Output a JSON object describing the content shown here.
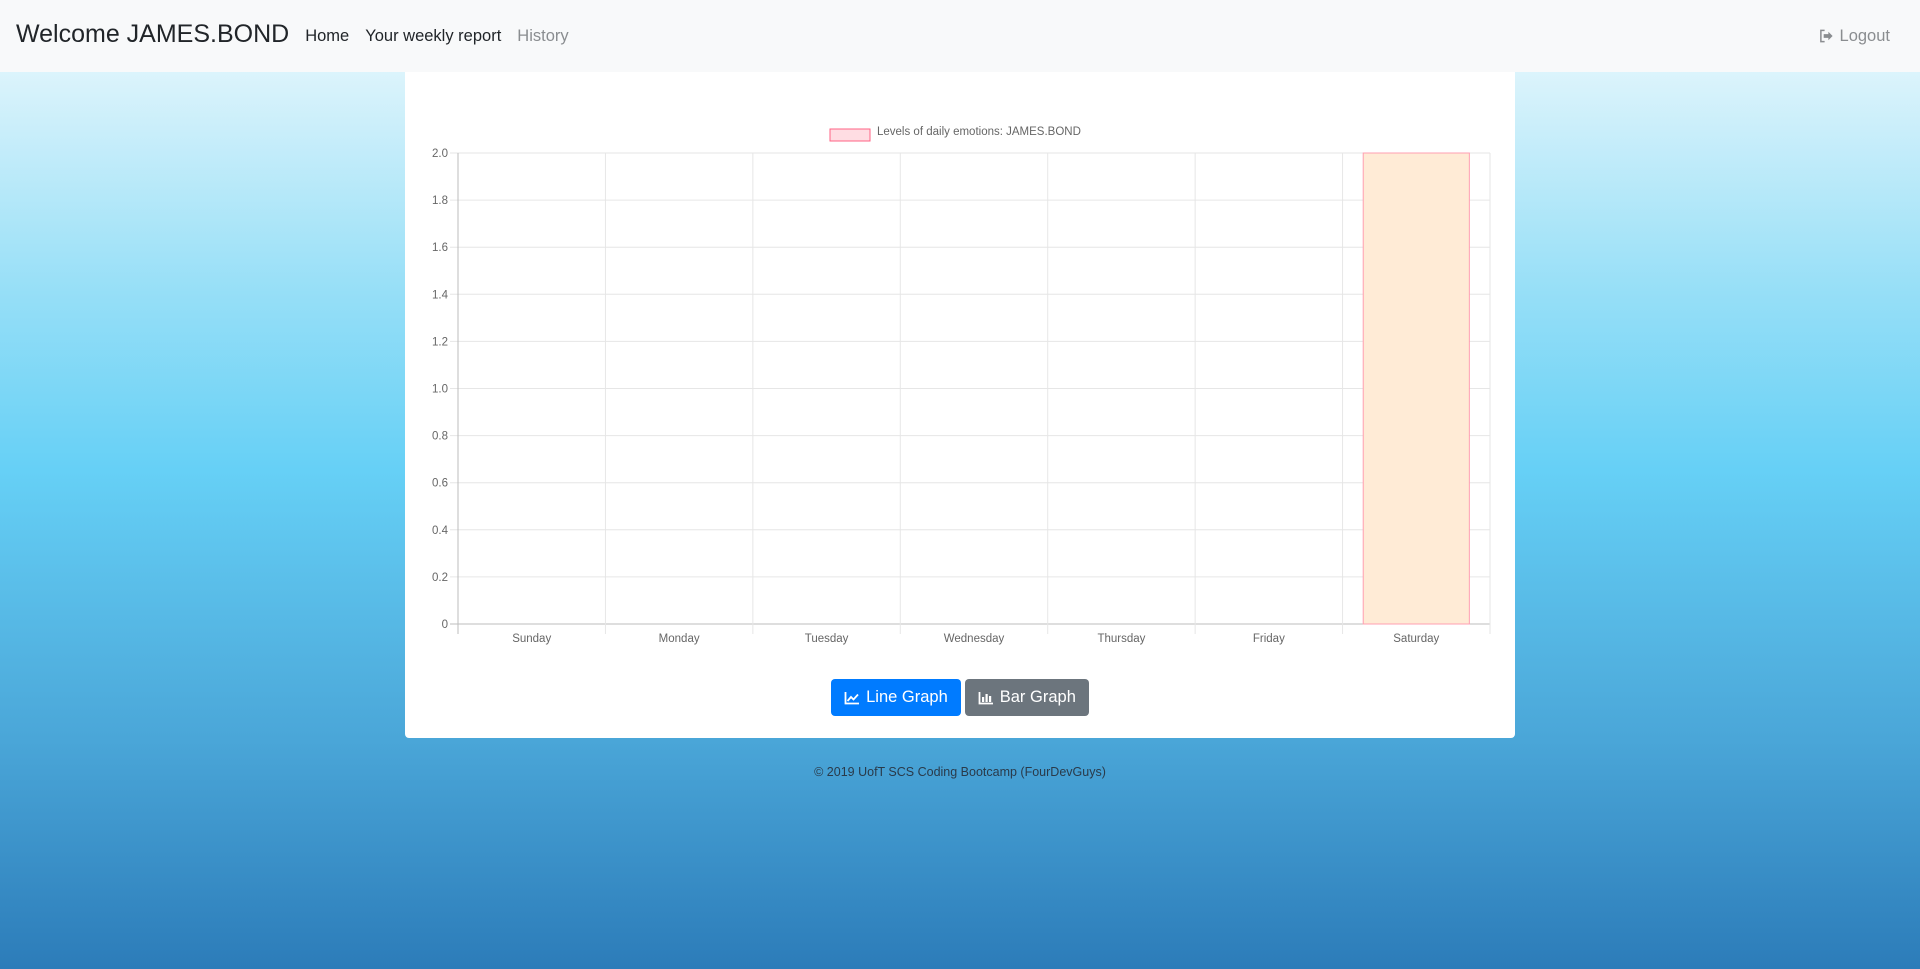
{
  "navbar": {
    "brand": "Welcome JAMES.BOND",
    "links": [
      {
        "label": "Home"
      },
      {
        "label": "Your weekly report"
      },
      {
        "label": "History"
      }
    ],
    "logout_label": "Logout"
  },
  "buttons": {
    "line_graph": "Line Graph",
    "bar_graph": "Bar Graph"
  },
  "footer": {
    "text": "© 2019 UofT SCS Coding Bootcamp (FourDevGuys)"
  },
  "colors": {
    "primary_button": "#007bff",
    "secondary_button": "#6c757d",
    "bar_fill": "#ffebd6",
    "bar_border": "#ff9fb1",
    "legend_fill": "#ffdde3",
    "legend_border": "#ff6384"
  },
  "icons": {
    "logout": "sign-out-icon",
    "line_graph": "line-chart-icon",
    "bar_graph": "bar-chart-icon"
  },
  "chart_data": {
    "type": "bar",
    "categories": [
      "Sunday",
      "Monday",
      "Tuesday",
      "Wednesday",
      "Thursday",
      "Friday",
      "Saturday"
    ],
    "series": [
      {
        "name": "Levels of daily emotions: JAMES.BOND",
        "values": [
          0,
          0,
          0,
          0,
          0,
          0,
          2
        ]
      }
    ],
    "yticks": [
      "0",
      "0.2",
      "0.4",
      "0.6",
      "0.8",
      "1.0",
      "1.2",
      "1.4",
      "1.6",
      "1.8",
      "2.0"
    ],
    "ylim": [
      0,
      2
    ],
    "grid": true,
    "legend_position": "top"
  }
}
